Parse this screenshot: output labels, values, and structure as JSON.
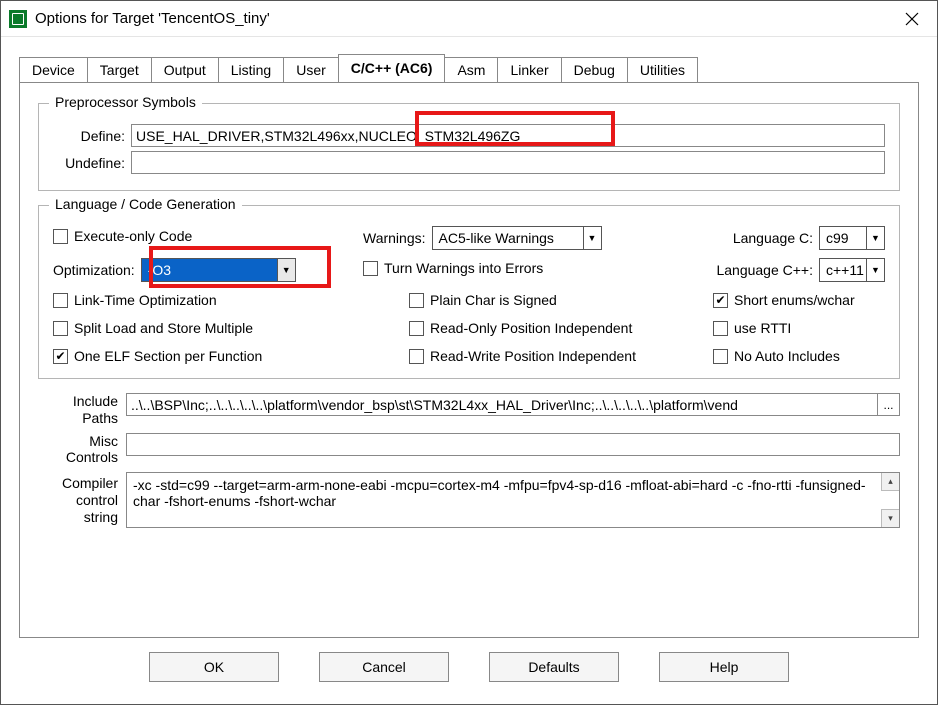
{
  "window": {
    "title": "Options for Target 'TencentOS_tiny'"
  },
  "tabs": [
    "Device",
    "Target",
    "Output",
    "Listing",
    "User",
    "C/C++ (AC6)",
    "Asm",
    "Linker",
    "Debug",
    "Utilities"
  ],
  "active_tab_index": 5,
  "preproc": {
    "legend": "Preprocessor Symbols",
    "define_label": "Define:",
    "define_value": "USE_HAL_DRIVER,STM32L496xx,NUCLEO_STM32L496ZG",
    "undefine_label": "Undefine:",
    "undefine_value": ""
  },
  "codegen": {
    "legend": "Language / Code Generation",
    "execute_only": {
      "label": "Execute-only Code",
      "checked": false
    },
    "warnings_label": "Warnings:",
    "warnings_value": "AC5-like Warnings",
    "lang_c_label": "Language C:",
    "lang_c_value": "c99",
    "optimization_label": "Optimization:",
    "optimization_value": "-O3",
    "turn_warn_err": {
      "label": "Turn Warnings into Errors",
      "checked": false
    },
    "lang_cpp_label": "Language C++:",
    "lang_cpp_value": "c++11",
    "lto": {
      "label": "Link-Time Optimization",
      "checked": false
    },
    "plain_char": {
      "label": "Plain Char is Signed",
      "checked": false
    },
    "short_enums": {
      "label": "Short enums/wchar",
      "checked": true
    },
    "split_load": {
      "label": "Split Load and Store Multiple",
      "checked": false
    },
    "ro_pi": {
      "label": "Read-Only Position Independent",
      "checked": false
    },
    "use_rtti": {
      "label": "use RTTI",
      "checked": false
    },
    "one_elf": {
      "label": "One ELF Section per Function",
      "checked": true
    },
    "rw_pi": {
      "label": "Read-Write Position Independent",
      "checked": false
    },
    "no_auto_inc": {
      "label": "No Auto Includes",
      "checked": false
    }
  },
  "paths": {
    "include_label": "Include\nPaths",
    "include_value": "..\\..\\BSP\\Inc;..\\..\\..\\..\\..\\platform\\vendor_bsp\\st\\STM32L4xx_HAL_Driver\\Inc;..\\..\\..\\..\\..\\platform\\vend",
    "misc_label": "Misc\nControls",
    "misc_value": "",
    "compiler_label": "Compiler\ncontrol\nstring",
    "compiler_value": "-xc -std=c99 --target=arm-arm-none-eabi -mcpu=cortex-m4 -mfpu=fpv4-sp-d16 -mfloat-abi=hard -c -fno-rtti -funsigned-char -fshort-enums -fshort-wchar"
  },
  "buttons": {
    "ok": "OK",
    "cancel": "Cancel",
    "defaults": "Defaults",
    "help": "Help"
  }
}
